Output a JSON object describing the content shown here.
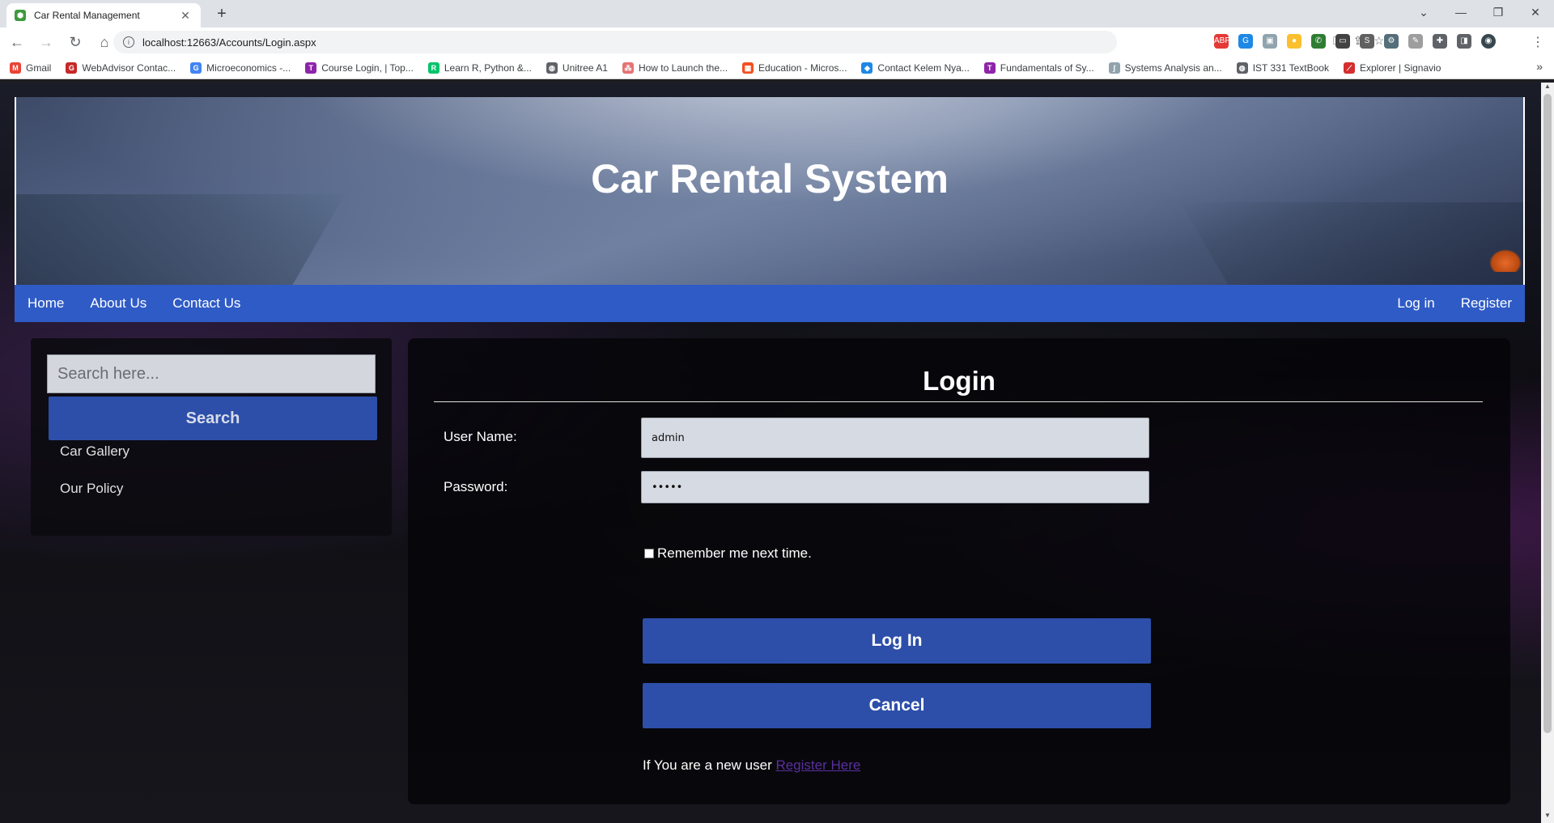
{
  "browser": {
    "tab_title": "Car Rental Management",
    "tab_close": "✕",
    "new_tab": "+",
    "url": "localhost:12663/Accounts/Login.aspx",
    "window_minimize": "—",
    "window_restore": "❐",
    "window_close": "✕",
    "tab_search": "⌄",
    "bookmarks": [
      {
        "label": "Gmail",
        "icon": "gmail-icon",
        "color": "#ea4335",
        "glyph": "M"
      },
      {
        "label": "WebAdvisor Contac...",
        "icon": "webadvisor-icon",
        "color": "#c62828",
        "glyph": "G"
      },
      {
        "label": "Microeconomics -...",
        "icon": "google-icon",
        "color": "#4285f4",
        "glyph": "G"
      },
      {
        "label": "Course Login, | Top...",
        "icon": "tophat-icon",
        "color": "#8e24aa",
        "glyph": "T"
      },
      {
        "label": "Learn R, Python &...",
        "icon": "datacamp-icon",
        "color": "#05c46b",
        "glyph": "R"
      },
      {
        "label": "Unitree A1",
        "icon": "globe-icon",
        "color": "#5f6368",
        "glyph": "◍"
      },
      {
        "label": "How to Launch the...",
        "icon": "pin-icon",
        "color": "#e57373",
        "glyph": "⁂"
      },
      {
        "label": "Education - Micros...",
        "icon": "microsoft-icon",
        "color": "#f25022",
        "glyph": "▦"
      },
      {
        "label": "Contact Kelem Nya...",
        "icon": "diamond-icon",
        "color": "#1e88e5",
        "glyph": "◆"
      },
      {
        "label": "Fundamentals of Sy...",
        "icon": "tophat-icon",
        "color": "#8e24aa",
        "glyph": "T"
      },
      {
        "label": "Systems Analysis an...",
        "icon": "bookmark-icon",
        "color": "#90a4ae",
        "glyph": "ʃ"
      },
      {
        "label": "IST 331 TextBook",
        "icon": "globe-icon",
        "color": "#5f6368",
        "glyph": "◍"
      },
      {
        "label": "Explorer | Signavio",
        "icon": "signavio-icon",
        "color": "#d32f2f",
        "glyph": "⟋"
      }
    ],
    "bookmarks_more": "»"
  },
  "header": {
    "title": "Car Rental System"
  },
  "nav": {
    "home": "Home",
    "about": "About Us",
    "contact": "Contact Us",
    "login": "Log in",
    "register": "Register"
  },
  "sidebar": {
    "search_placeholder": "Search here...",
    "search_button": "Search",
    "links": [
      "Car Gallery",
      "Our Policy"
    ]
  },
  "login": {
    "title": "Login",
    "username_label": "User Name:",
    "username_value": "admin",
    "password_label": "Password:",
    "password_value": "•••••",
    "remember_label": "Remember me next time.",
    "login_button": "Log In",
    "cancel_button": "Cancel",
    "new_user_text": "If You are a new user ",
    "register_link": "Register Here"
  },
  "colors": {
    "nav_blue": "#2f5bc6",
    "button_blue": "#2d4fa9",
    "link_purple": "#5a2fa0"
  }
}
